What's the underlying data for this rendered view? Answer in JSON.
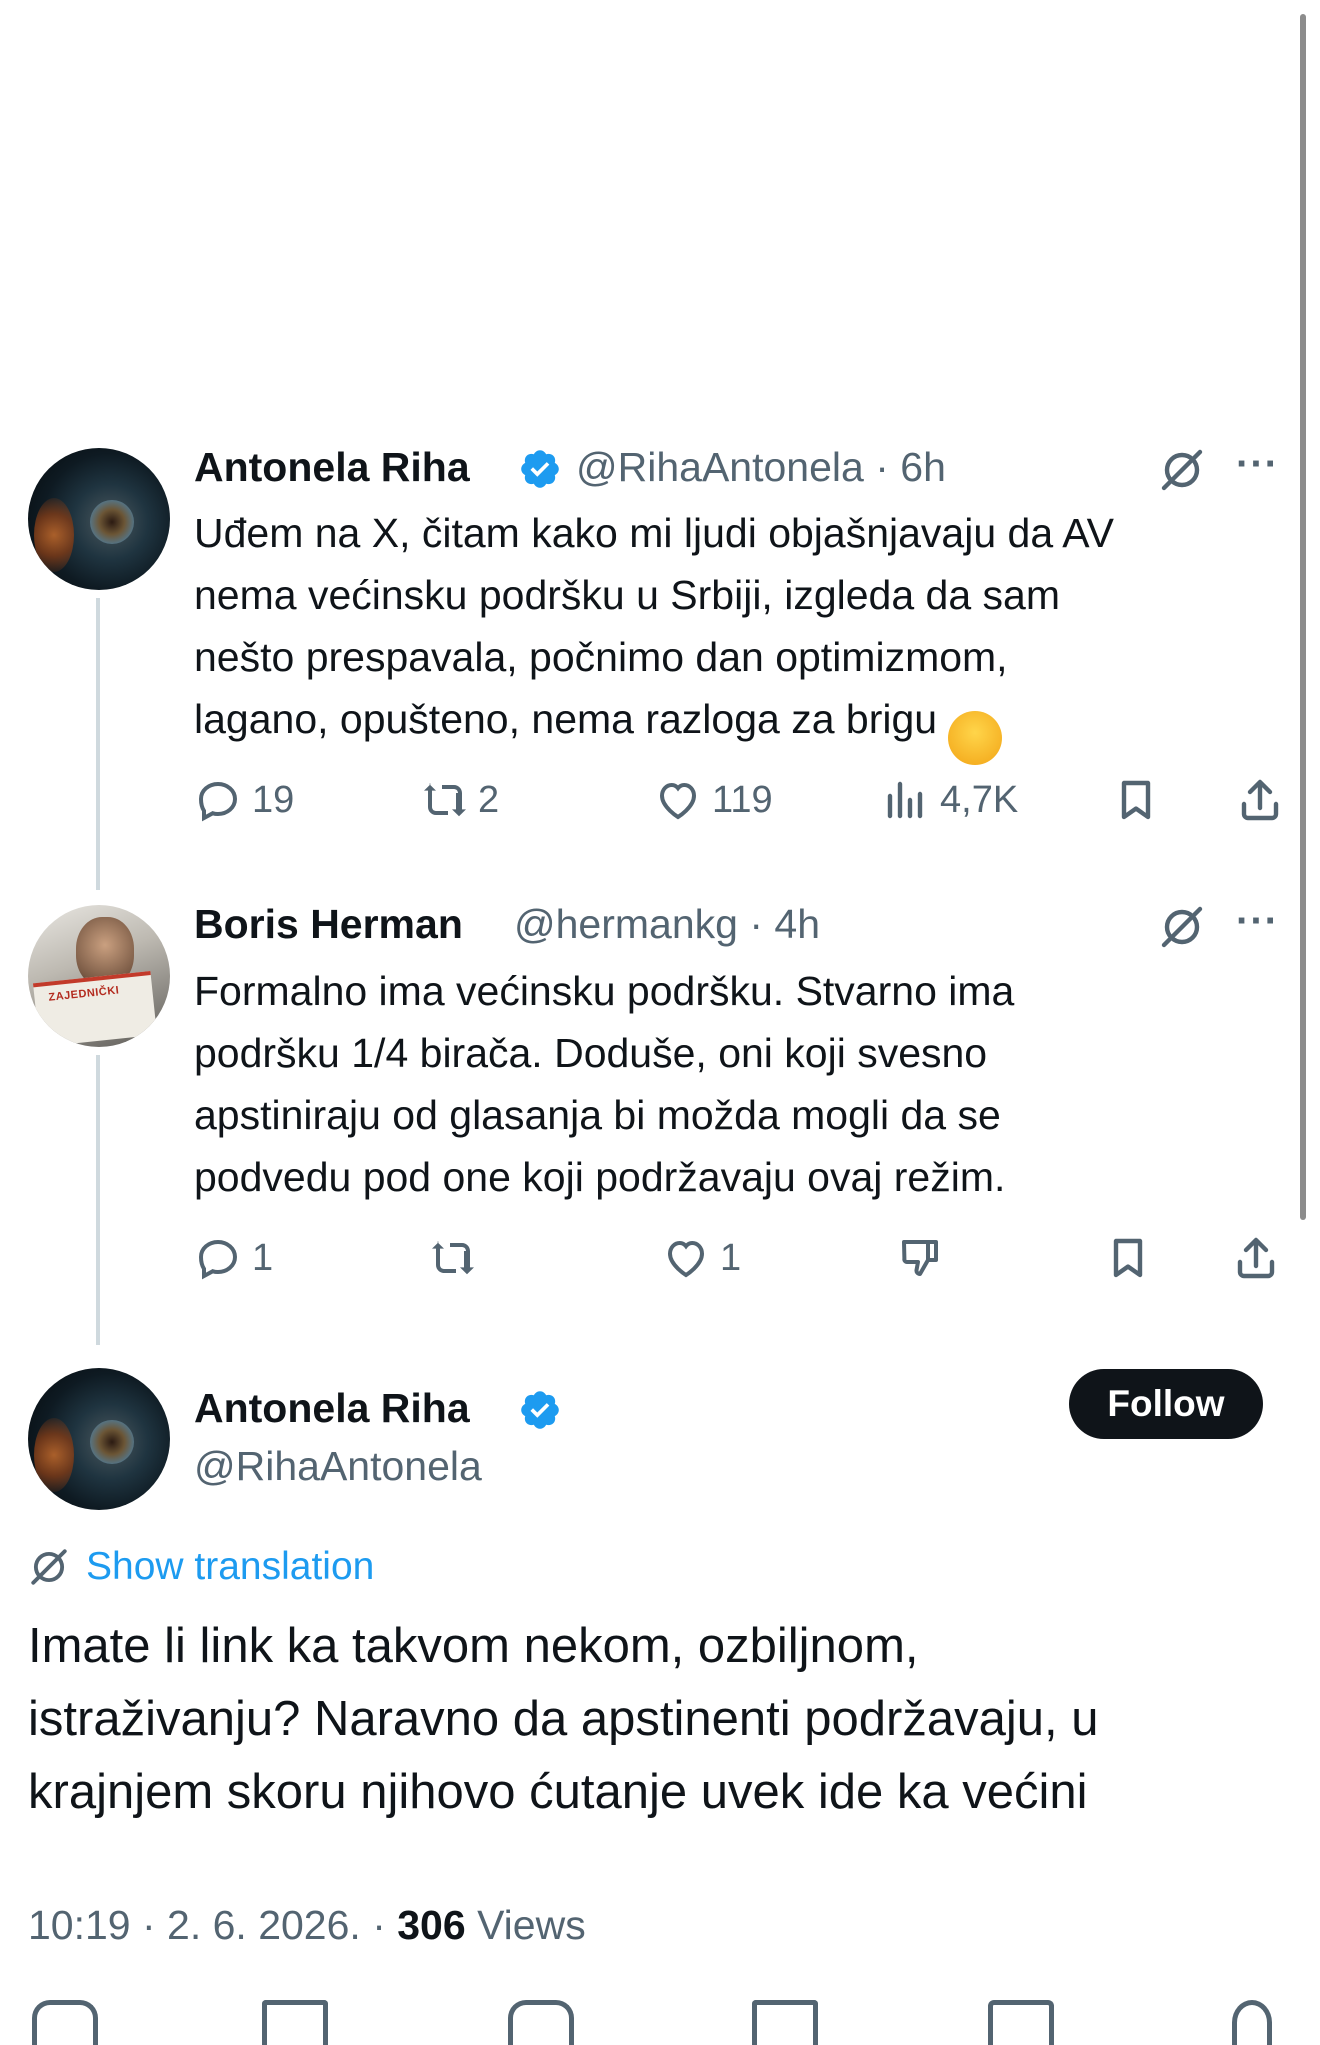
{
  "tweets": [
    {
      "name": "Antonela Riha",
      "handle": "@RihaAntonela",
      "time": "· 6h",
      "more": "···",
      "text": "Uđem na X, čitam kako mi ljudi objašnjavaju da AV\nnema većinsku podršku u Srbiji, izgleda da sam\nnešto prespavala, počnimo dan optimizmom,\nlagano, opušteno, nema razloga za brigu",
      "emoji": "😑",
      "actions": {
        "replies": "19",
        "reposts": "2",
        "likes": "119",
        "views": "4,7K"
      }
    },
    {
      "name": "Boris Herman",
      "handle": "@hermankg",
      "time": "· 4h",
      "more": "···",
      "avatar_caption": "ZAJEDNIČKI",
      "text": "Formalno ima većinsku podršku. Stvarno ima\npodršku 1/4 birača. Doduše, oni koji svesno\napstiniraju od glasanja bi možda mogli da se\npodvedu pod one koji podržavaju ovaj režim.",
      "actions": {
        "replies": "1",
        "reposts": "",
        "likes": "1"
      }
    }
  ],
  "main": {
    "name": "Antonela Riha",
    "handle": "@RihaAntonela",
    "follow_label": "Follow",
    "show_translation": "Show translation",
    "text": "Imate li link ka takvom nekom, ozbiljnom,\nistraživanju? Naravno da apstinenti podržavaju, u\nkrajnjem skoru njihovo ćutanje uvek ide ka većini",
    "time": "10:19 · 2. 6. 2026. · ",
    "views_count": "306",
    "views_label": " Views"
  },
  "colors": {
    "accent": "#1d9bf0",
    "text": "#0f1419",
    "muted": "#536471",
    "line": "#cfd9de"
  },
  "icons": [
    "verified-badge-icon",
    "translate-icon",
    "more-icon",
    "reply-icon",
    "repost-icon",
    "like-icon",
    "views-icon",
    "bookmark-icon",
    "share-icon",
    "downvote-icon"
  ]
}
